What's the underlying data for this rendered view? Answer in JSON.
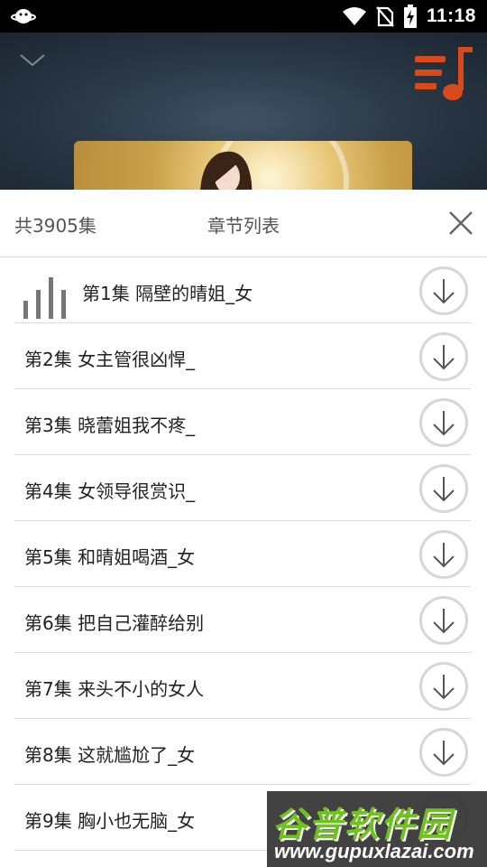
{
  "status_bar": {
    "time": "11:18",
    "icons": [
      "app-notification-icon",
      "wifi-icon",
      "no-sim-icon",
      "battery-charging-icon"
    ]
  },
  "player": {
    "collapse_icon": "chevron-down-icon",
    "playlist_icon": "playlist-music-icon",
    "accent_color": "#d94a1a"
  },
  "sheet": {
    "total": "共3905集",
    "title": "章节列表",
    "close_icon": "close-icon"
  },
  "episodes": [
    {
      "title": "第1集 隔壁的晴姐_女",
      "playing": true
    },
    {
      "title": "第2集 女主管很凶悍_"
    },
    {
      "title": "第3集 晓蕾姐我不疼_"
    },
    {
      "title": "第4集 女领导很赏识_"
    },
    {
      "title": "第5集 和晴姐喝酒_女"
    },
    {
      "title": "第6集 把自己灌醉给别"
    },
    {
      "title": "第7集 来头不小的女人"
    },
    {
      "title": "第8集 这就尴尬了_女"
    },
    {
      "title": "第9集 胸小也无脑_女"
    }
  ],
  "watermark": {
    "name": "谷普软件园",
    "url": "www.gupuxlazai.com"
  }
}
